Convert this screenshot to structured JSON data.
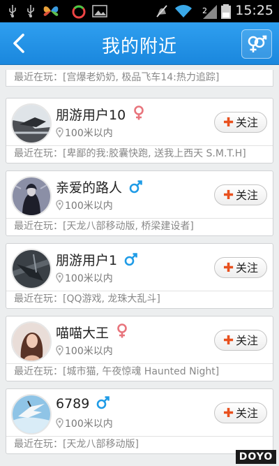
{
  "status_bar": {
    "time": "15:25"
  },
  "app_bar": {
    "title": "我的附近"
  },
  "partial_item": {
    "recent": "最近在玩：[宫爆老奶奶, 极品飞车14:热力追踪]"
  },
  "users": [
    {
      "name": "朋游用户10",
      "gender": "female",
      "distance": "100米以内",
      "follow_label": "关注",
      "recent": "最近在玩：[卑鄙的我:胶囊快跑, 送我上西天 S.M.T.H]"
    },
    {
      "name": "亲爱的路人",
      "gender": "male",
      "distance": "100米以内",
      "follow_label": "关注",
      "recent": "最近在玩：[天龙八部移动版, 桥梁建设者]"
    },
    {
      "name": "朋游用户1",
      "gender": "male",
      "distance": "100米以内",
      "follow_label": "关注",
      "recent": "最近在玩：[QQ游戏, 龙珠大乱斗]"
    },
    {
      "name": "喵喵大王",
      "gender": "female",
      "distance": "100米以内",
      "follow_label": "关注",
      "recent": "最近在玩：[城市猫, 午夜惊魂 Haunted Night]"
    },
    {
      "name": "6789",
      "gender": "male",
      "distance": "100米以内",
      "follow_label": "关注",
      "recent": "最近在玩：[天龙八部移动版]"
    }
  ],
  "colors": {
    "accent": "#1f8fe6",
    "male": "#1e9be6",
    "female": "#e8747c",
    "follow_plus": "#e8501e"
  },
  "watermark": "DOYO"
}
